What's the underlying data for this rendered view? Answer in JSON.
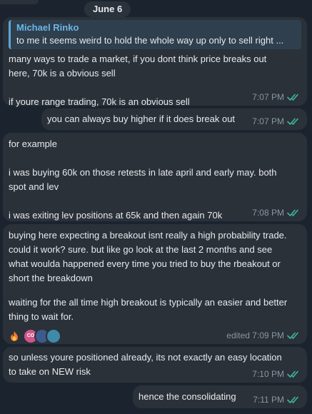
{
  "date_label": "June 6",
  "colors": {
    "accent": "#6ab6ea",
    "bubble": "#2a3139",
    "background": "#1b242e",
    "check": "#3fb5a3"
  },
  "messages": [
    {
      "reply": {
        "name": "Michael Rinko",
        "text": "to me it seems weird to hold the whole way up only to sell right ..."
      },
      "lines": [
        "many ways to trade a market, if you dont think price breaks out",
        "here, 70k is a obvious sell",
        "",
        "if youre range trading, 70k is an obvious sell"
      ],
      "time": "7:07 PM"
    },
    {
      "lines": [
        "you can always buy higher if it does break out"
      ],
      "time": "7:07 PM"
    },
    {
      "lines": [
        "for example",
        "",
        "i was buying 60k on those retests in late april and early may. both",
        "spot and lev",
        "",
        "i was exiting lev positions at 65k and then again 70k"
      ],
      "time": "7:08 PM"
    },
    {
      "lines": [
        "buying here expecting a breakout isnt really a high probability trade.",
        "could it work? sure. but like go look at the last 2 months and see",
        "what woulda happened every time you tried to buy the rbeakout or",
        "short the breakdown",
        "",
        "waiting for the all time high breakout is typically an easier and better",
        "thing to wait for."
      ],
      "time": "edited 7:09 PM",
      "reactions": {
        "emoji": "fire-icon",
        "avatars": [
          {
            "label": "CO",
            "color": "#d0568a"
          },
          {
            "label": "",
            "color": "#3c5a8c"
          },
          {
            "label": "",
            "color": "#3f8aa8"
          }
        ]
      }
    },
    {
      "lines": [
        "so unless youre positioned already, its not exactly an easy location",
        "to take on NEW risk"
      ],
      "time": "7:10 PM"
    },
    {
      "lines": [
        "hence the consolidating"
      ],
      "time": "7:11 PM"
    }
  ]
}
